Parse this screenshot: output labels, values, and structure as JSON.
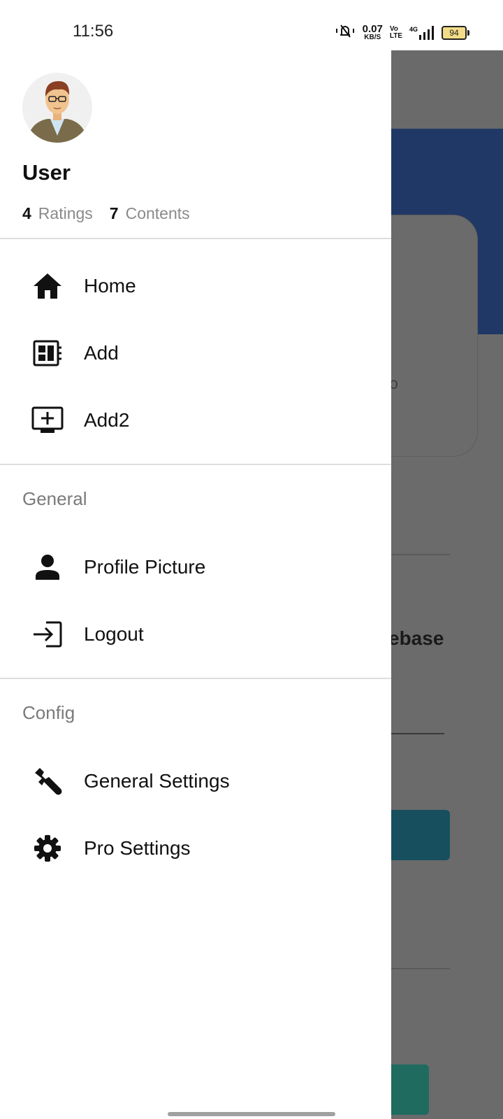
{
  "status_bar": {
    "time": "11:56",
    "net_speed_value": "0.07",
    "net_speed_unit": "KB/S",
    "volte_top": "Vo",
    "volte_bottom": "LTE",
    "network": "4G",
    "battery": "94"
  },
  "drawer": {
    "user_name": "User",
    "stats": [
      {
        "count": "4",
        "label": "Ratings"
      },
      {
        "count": "7",
        "label": "Contents"
      }
    ],
    "main_items": [
      {
        "label": "Home",
        "icon": "home-icon"
      },
      {
        "label": "Add",
        "icon": "dashboard-icon"
      },
      {
        "label": "Add2",
        "icon": "add-to-queue-icon"
      }
    ],
    "general_title": "General",
    "general_items": [
      {
        "label": "Profile Picture",
        "icon": "person-icon"
      },
      {
        "label": "Logout",
        "icon": "login-icon"
      }
    ],
    "config_title": "Config",
    "config_items": [
      {
        "label": "General Settings",
        "icon": "wrench-icon"
      },
      {
        "label": "Pro Settings",
        "icon": "gear-icon"
      }
    ]
  },
  "background": {
    "card_text_fragment": "io",
    "heading_fragment": "ebase"
  }
}
